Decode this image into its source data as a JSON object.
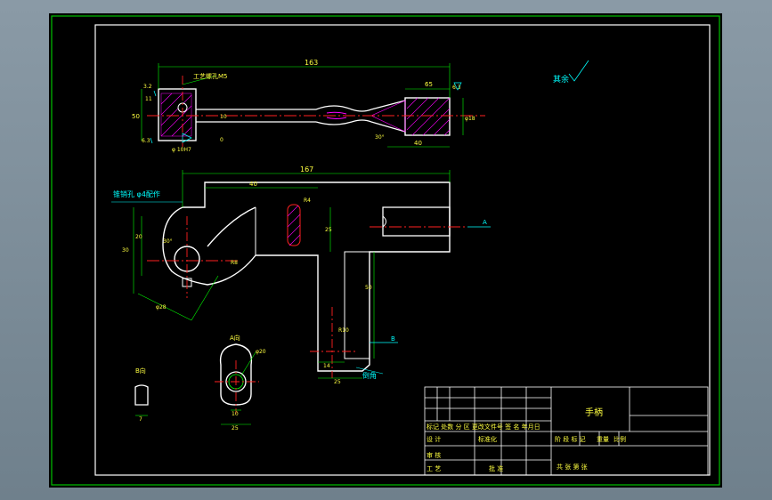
{
  "colors": {
    "background": "#000000",
    "outline": "#ffffff",
    "frame": "#00c000",
    "dimension": "#00ff00",
    "centerline": "#ff2020",
    "hatch": "#ff00ff",
    "text": "#ffff40",
    "symbol": "#00ffff"
  },
  "top_view": {
    "length_dim": "163",
    "hole_label": "工艺螺孔M5",
    "height_dim": "50",
    "dim_11": "11",
    "dim_10": "10",
    "dim_0": "0",
    "dim_65": "65",
    "dim_40": "40",
    "dim_dia": "φ18",
    "angle": "30°",
    "rough_left_top": "3.2",
    "rough_left_bottom": "6.3",
    "bore_label": "φ 10H7",
    "rough_right": "6.3"
  },
  "front_view": {
    "length_dim": "167",
    "inner_dim": "40",
    "pin_hole_label": "锥销孔 φ4配作",
    "dim_20": "20",
    "dim_25": "25",
    "dim_30": "30",
    "dim_r": "R8",
    "dim_r4": "R4",
    "dim_ang": "30°",
    "dim_diag": "φ28",
    "dim_16": "16",
    "dim_18": "18",
    "dim_50": "50",
    "dim_r10": "R10",
    "dim_14": "14",
    "dim_25b": "25",
    "section_a": "A",
    "section_b": "B",
    "note_chamfer": "倒角"
  },
  "a_view": {
    "title": "A向",
    "dim_dia": "φ20",
    "dim_10": "10",
    "dim_25": "25"
  },
  "b_view": {
    "title": "B向",
    "dim_7": "7"
  },
  "roughness_note": "其余",
  "title_block": {
    "part_name": "手柄",
    "revision_header": "标记 处数 分 区 更改文件号 签 名 年月日",
    "design": "设 计",
    "standardize": "标准化",
    "stage_marks": "阶 段 标 记",
    "weight": "重量",
    "scale": "比例",
    "review": "审 核",
    "process": "工 艺",
    "approve": "批 准",
    "sheets": "共 张 第 张"
  }
}
